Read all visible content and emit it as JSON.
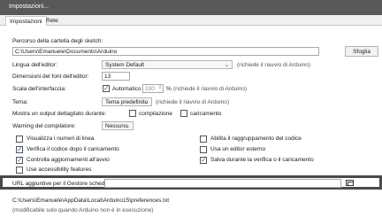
{
  "window": {
    "title": "Impostazioni..."
  },
  "tabs": [
    {
      "label": "Impostazioni"
    },
    {
      "label": "Rete"
    }
  ],
  "sketchbook": {
    "label": "Percorso della cartella degli sketch:",
    "value": "C:\\Users\\Emanuele\\Documents\\Arduino",
    "browse_label": "Sfoglia"
  },
  "language": {
    "label": "Lingua dell'editor:",
    "value": "System Default",
    "note": "(richiede il riavvio di Arduino)"
  },
  "font_size": {
    "label": "Dimensioni del font dell'editor:",
    "value": "13"
  },
  "scale": {
    "label": "Scala dell'interfaccia:",
    "auto_label": "Automatico",
    "value": "100",
    "unit": "%",
    "note": "(richiede il riavvio di Arduino)"
  },
  "theme": {
    "label": "Tema:",
    "value": "Tema predefinito",
    "note": "(richiede il riavvio di Arduino)"
  },
  "verbose": {
    "label": "Mostra un output dettagliato durante:",
    "compile_label": "compilazione",
    "upload_label": "caricamento"
  },
  "warnings": {
    "label": "Warning del compilatore:",
    "value": "Nessuno"
  },
  "options_left": [
    {
      "label": "Visualizza i numeri di linea",
      "checked": false
    },
    {
      "label": "Verifica il codice dopo il caricamento",
      "checked": true
    },
    {
      "label": "Controlla aggiornamenti all'avvio",
      "checked": true
    },
    {
      "label": "Use accessibility features",
      "checked": false
    }
  ],
  "options_right": [
    {
      "label": "Abilita il raggruppamento del codice",
      "checked": false
    },
    {
      "label": "Usa un editor esterno",
      "checked": false
    },
    {
      "label": "Salva durante la verifica o il caricamento",
      "checked": true
    }
  ],
  "board_urls": {
    "label": "URL aggiuntive per il Gestore schede:",
    "value": ""
  },
  "prefs_path": {
    "value": "C:\\Users\\Emanuele\\AppData\\Local\\Arduino15\\preferences.txt",
    "note": "(modificabile solo quando Arduino non è in esecuzione)"
  },
  "colors": {
    "titlebar": "#595959",
    "accent": "#1f6fd6",
    "highlight_border": "#4a4a4a"
  },
  "icons": {
    "checkmark": "checkmark-icon",
    "chevron": "chevron-down-icon",
    "folder": "folder-icon"
  }
}
